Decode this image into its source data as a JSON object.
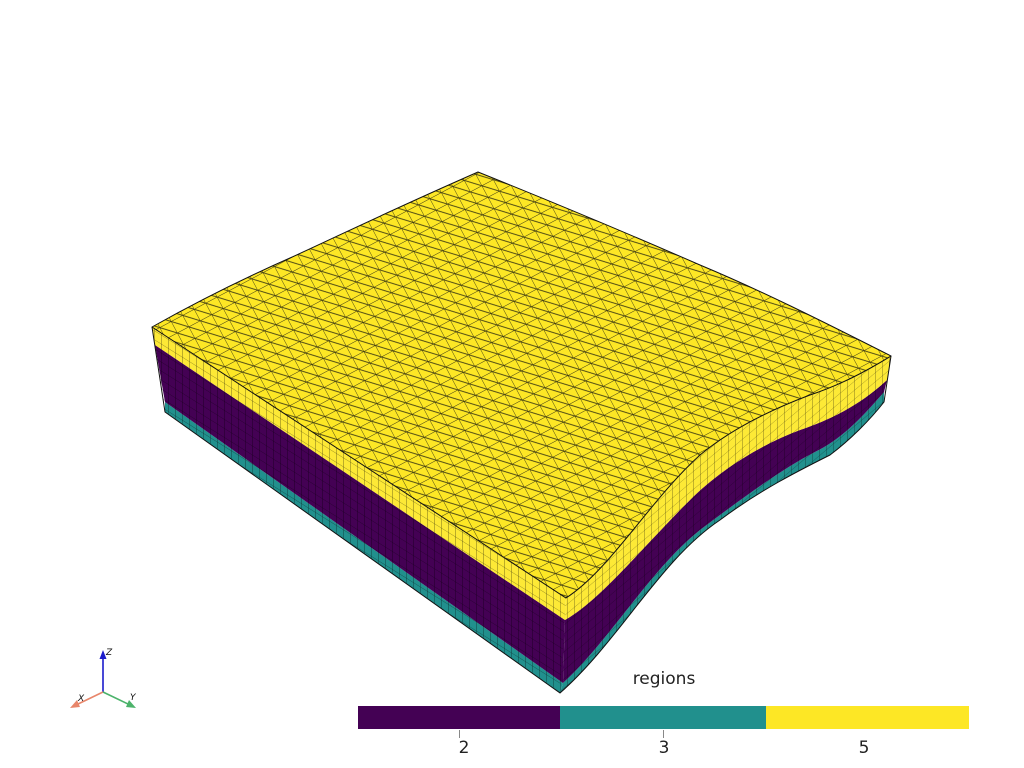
{
  "scene": {
    "colors": {
      "region_2": "#440154",
      "region_3": "#21908d",
      "region_5": "#fde725",
      "edges": "#000000",
      "background": "#ffffff"
    }
  },
  "axes_widget": {
    "x_label": "X",
    "y_label": "Y",
    "z_label": "Z",
    "x_color": "#e8866b",
    "y_color": "#4cb36b",
    "z_color": "#1c1ccc"
  },
  "colorbar": {
    "title": "regions",
    "segments": [
      {
        "label": "2",
        "color": "#440154"
      },
      {
        "label": "3",
        "color": "#21908d"
      },
      {
        "label": "5",
        "color": "#fde725"
      }
    ]
  }
}
